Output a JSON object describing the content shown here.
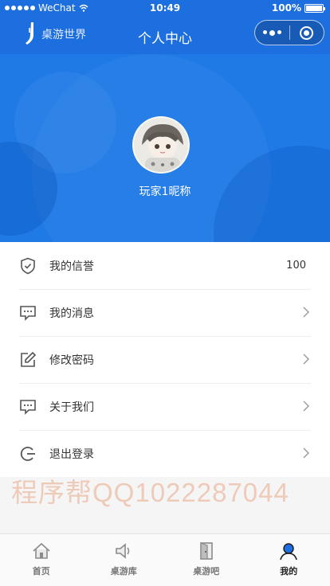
{
  "status_bar": {
    "carrier": "WeChat",
    "time": "10:49",
    "battery": "100%"
  },
  "header": {
    "logo_text": "桌游世界",
    "title": "个人中心"
  },
  "profile": {
    "nickname": "玩家1昵称"
  },
  "menu": [
    {
      "label": "我的信誉",
      "value": "100",
      "icon": "shield-check-icon"
    },
    {
      "label": "我的消息",
      "icon": "message-icon"
    },
    {
      "label": "修改密码",
      "icon": "edit-icon"
    },
    {
      "label": "关于我们",
      "icon": "message-icon"
    },
    {
      "label": "退出登录",
      "icon": "logout-icon"
    }
  ],
  "watermark": "程序帮QQ1022287044",
  "tabbar": [
    {
      "label": "首页",
      "icon": "home-icon"
    },
    {
      "label": "桌游库",
      "icon": "speaker-icon"
    },
    {
      "label": "桌游吧",
      "icon": "door-icon"
    },
    {
      "label": "我的",
      "icon": "user-icon",
      "active": true
    }
  ],
  "colors": {
    "primary": "#1d6fe0",
    "banner": "#1f7ae6",
    "active_tab": "#1d6fe0"
  }
}
